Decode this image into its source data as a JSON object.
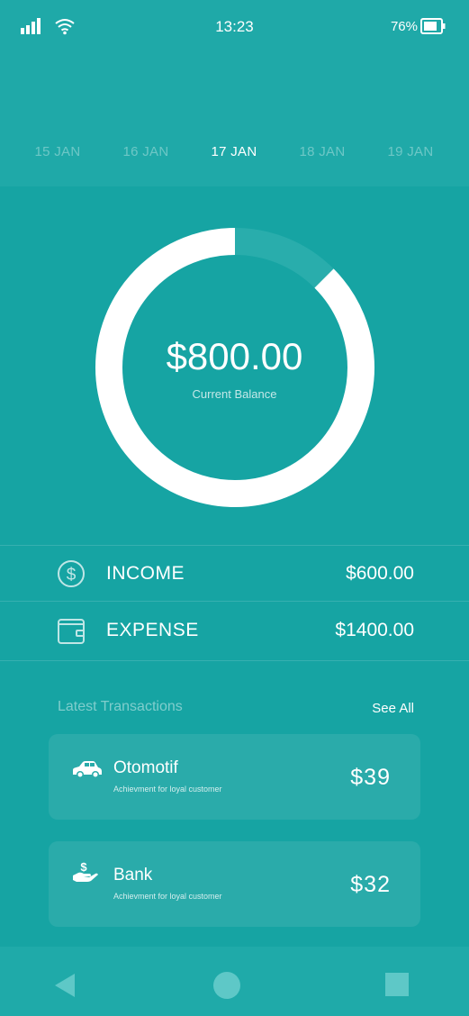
{
  "status": {
    "time": "13:23",
    "battery_pct": "76%"
  },
  "dates": [
    {
      "label": "15 JAN",
      "active": false
    },
    {
      "label": "16 JAN",
      "active": false
    },
    {
      "label": "17 JAN",
      "active": true
    },
    {
      "label": "18 JAN",
      "active": false
    },
    {
      "label": "19 JAN",
      "active": false
    }
  ],
  "summary": {
    "balance": "$800.00",
    "balance_label": "Current Balance",
    "ring_progress": 0.875
  },
  "income": {
    "label": "INCOME",
    "value": "$600.00",
    "icon": "dollar-circle-icon"
  },
  "expense": {
    "label": "EXPENSE",
    "value": "$1400.00",
    "icon": "wallet-icon"
  },
  "transactions": {
    "heading": "Latest Transactions",
    "see_all": "See All",
    "items": [
      {
        "title": "Otomotif",
        "subtitle": "Achievment for loyal customer",
        "amount": "$39",
        "icon": "car-icon"
      },
      {
        "title": "Bank",
        "subtitle": "Achievment for loyal customer",
        "amount": "$32",
        "icon": "hand-dollar-icon"
      }
    ]
  },
  "colors": {
    "background": "#16a4a3",
    "header": "#1fa9a8",
    "card": "#2aabaa",
    "accent": "#ffffff"
  }
}
